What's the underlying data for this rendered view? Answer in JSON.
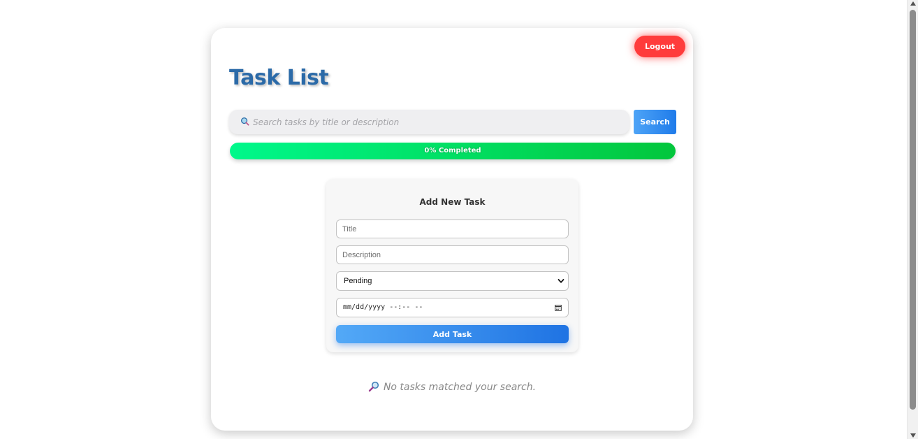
{
  "header": {
    "logout_label": "Logout",
    "title": "Task List"
  },
  "search": {
    "placeholder": "Search tasks by title or description",
    "button_label": "Search",
    "icon": "search-icon"
  },
  "progress": {
    "percent": 0,
    "label": "0% Completed",
    "colors": [
      "#00f88b",
      "#02c63c"
    ]
  },
  "form": {
    "title": "Add New Task",
    "title_placeholder": "Title",
    "description_placeholder": "Description",
    "status_selected": "Pending",
    "status_options": [
      "Pending"
    ],
    "datetime_placeholder": "mm/dd/yyyy --:-- --",
    "submit_label": "Add Task"
  },
  "empty_state": {
    "message": "No tasks matched your search.",
    "icon": "magnify-icon"
  },
  "colors": {
    "logout": "#ff3b3b",
    "title": "#2b6aa8",
    "accent": "#1f7bea"
  }
}
